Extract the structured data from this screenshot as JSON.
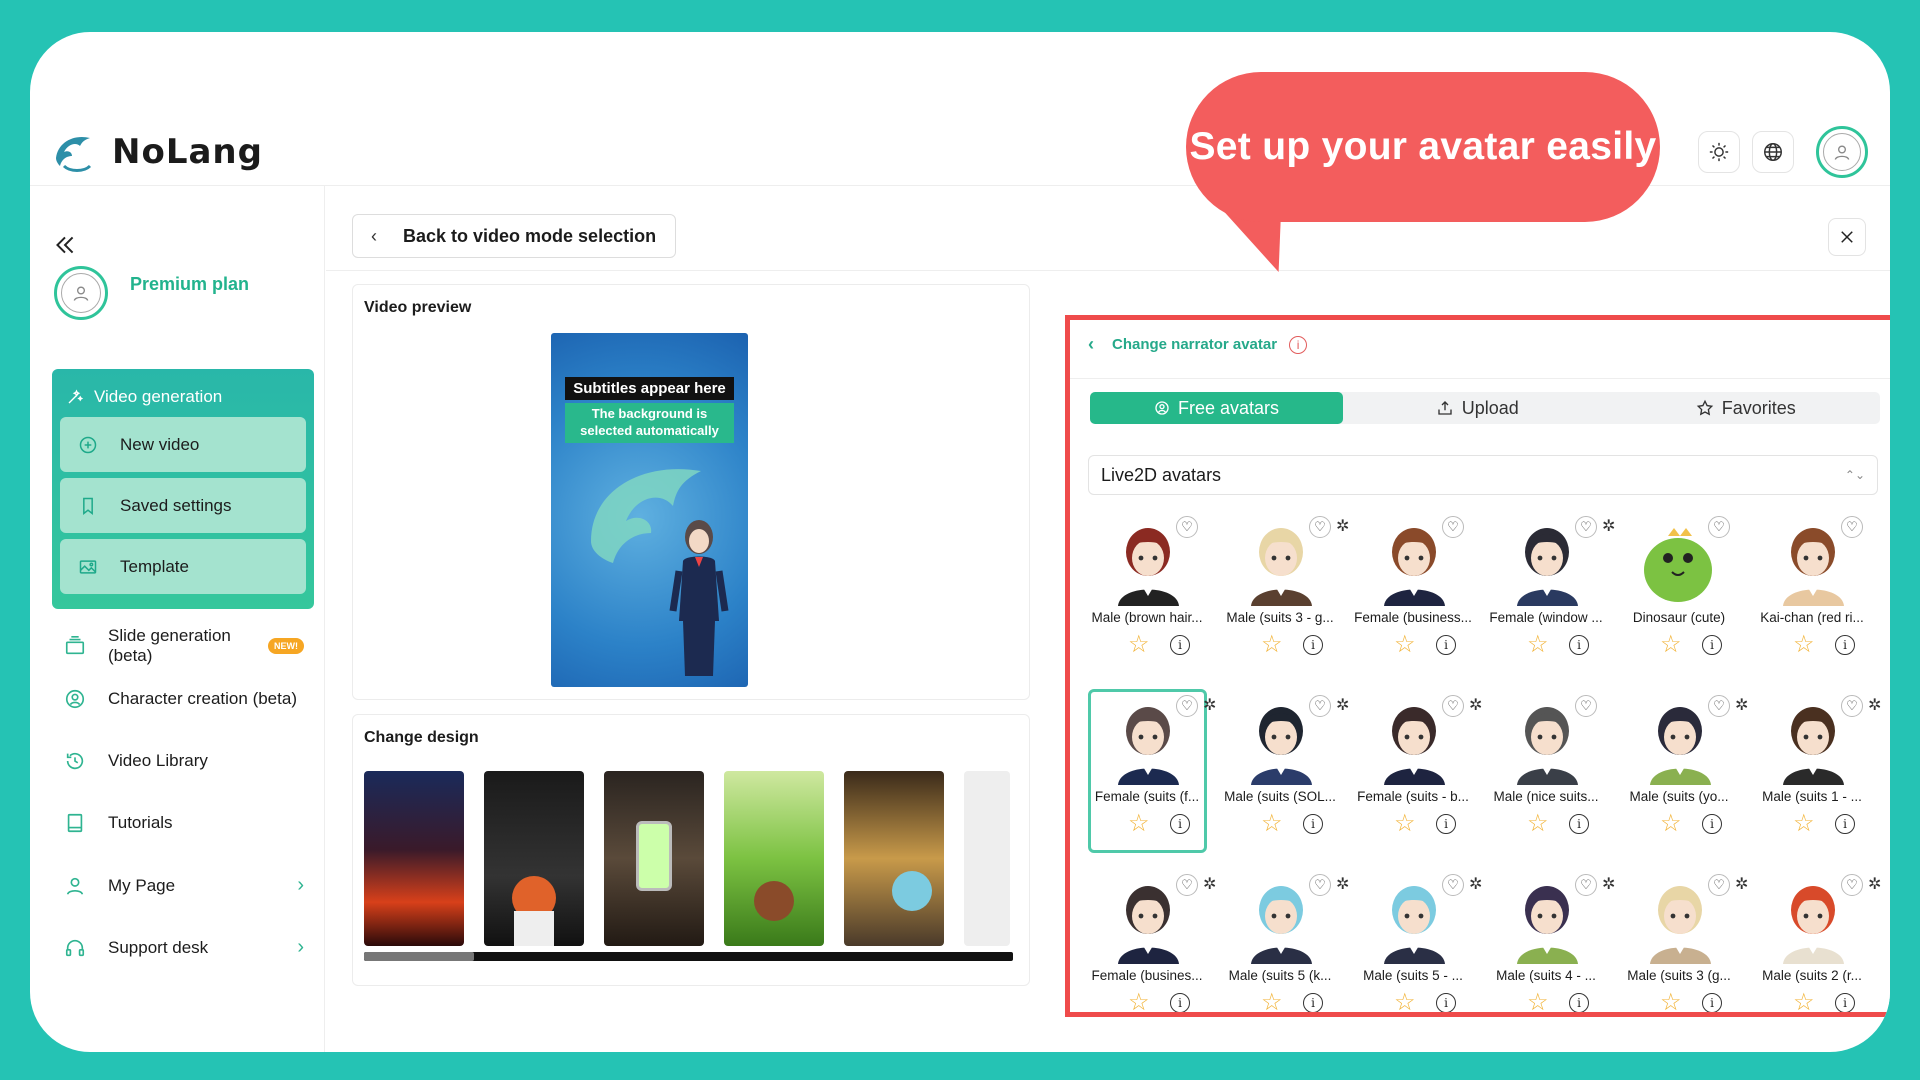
{
  "app": {
    "name": "NoLang"
  },
  "callout": {
    "text": "Set up your avatar easily"
  },
  "header": {
    "theme_icon": "sun-icon",
    "language_icon": "globe-icon",
    "user_icon": "user-icon"
  },
  "sidebar": {
    "plan_label": "Premium plan",
    "video_generation": {
      "label": "Video generation",
      "items": [
        {
          "label": "New video",
          "icon": "plus-circle-icon"
        },
        {
          "label": "Saved settings",
          "icon": "bookmark-icon"
        },
        {
          "label": "Template",
          "icon": "image-icon"
        }
      ]
    },
    "links": [
      {
        "label": "Slide generation (beta)",
        "icon": "slides-icon",
        "badge": "NEW!"
      },
      {
        "label": "Character creation (beta)",
        "icon": "character-icon"
      },
      {
        "label": "Video Library",
        "icon": "history-icon"
      },
      {
        "label": "Tutorials",
        "icon": "book-icon"
      },
      {
        "label": "My Page",
        "icon": "user-icon",
        "chevron": true
      },
      {
        "label": "Support desk",
        "icon": "headset-icon",
        "chevron": true
      }
    ]
  },
  "main": {
    "back_label": "Back to video mode selection",
    "video_preview": {
      "title": "Video preview",
      "subtitle_line": "Subtitles appear here",
      "background_line": "The background is selected automatically"
    },
    "change_design": {
      "title": "Change design"
    }
  },
  "avatar_panel": {
    "title": "Change narrator avatar",
    "tabs": [
      {
        "label": "Free avatars",
        "icon": "user-circle-icon",
        "active": true
      },
      {
        "label": "Upload",
        "icon": "upload-icon",
        "active": false
      },
      {
        "label": "Favorites",
        "icon": "star-icon",
        "active": false
      }
    ],
    "select_value": "Live2D avatars",
    "avatars": [
      {
        "name": "Male (brown hair...",
        "hair": "#8b2a22",
        "suit": "#222"
      },
      {
        "name": "Male (suits 3 - g...",
        "hair": "#e8d6a6",
        "suit": "#5a4030"
      },
      {
        "name": "Female (business...",
        "hair": "#8a4a2a",
        "suit": "#1e2440"
      },
      {
        "name": "Female (window ...",
        "hair": "#2b2b35",
        "suit": "#2a3a60"
      },
      {
        "name": "Dinosaur (cute)",
        "hair": "#7cc242",
        "suit": "#7cc242"
      },
      {
        "name": "Kai-chan (red ri...",
        "hair": "#8a4b2a",
        "suit": "#e8c8a0"
      },
      {
        "name": "Female (suits (f...",
        "hair": "#5a4a48",
        "suit": "#1c2a50",
        "selected": true
      },
      {
        "name": "Male (suits (SOL...",
        "hair": "#1f2530",
        "suit": "#2b3c6a"
      },
      {
        "name": "Female (suits - b...",
        "hair": "#3a2a2a",
        "suit": "#1e2440"
      },
      {
        "name": "Male (nice suits...",
        "hair": "#555",
        "suit": "#3a3f48"
      },
      {
        "name": "Male (suits (yo...",
        "hair": "#2a2a3a",
        "suit": "#8ab050"
      },
      {
        "name": "Male (suits 1 - ...",
        "hair": "#4a3020",
        "suit": "#2a2a2a"
      },
      {
        "name": "Female (busines...",
        "hair": "#3a3030",
        "suit": "#1e2440"
      },
      {
        "name": "Male (suits 5 (k...",
        "hair": "#7ccbe0",
        "suit": "#2a2f45"
      },
      {
        "name": "Male (suits 5 - ...",
        "hair": "#7ccbe0",
        "suit": "#2a2f45"
      },
      {
        "name": "Male (suits 4 - ...",
        "hair": "#3a3050",
        "suit": "#8ab050"
      },
      {
        "name": "Male (suits 3 (g...",
        "hair": "#e8d6a6",
        "suit": "#c8b090"
      },
      {
        "name": "Male (suits 2 (r...",
        "hair": "#d84a2a",
        "suit": "#e8e0d0"
      }
    ]
  },
  "colors": {
    "accent": "#26b88a",
    "background": "#25c3b4",
    "callout": "#f35d5d",
    "highlight_border": "#ef4b4b"
  }
}
